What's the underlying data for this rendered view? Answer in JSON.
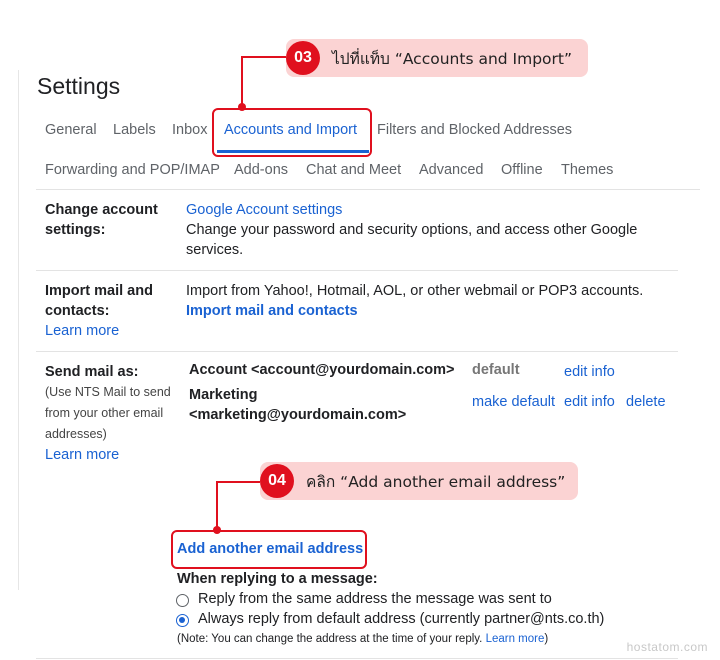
{
  "page_title": "Settings",
  "tabs": {
    "row1": [
      "General",
      "Labels",
      "Inbox",
      "Accounts and Import",
      "Filters and Blocked Addresses"
    ],
    "row2": [
      "Forwarding and POP/IMAP",
      "Add-ons",
      "Chat and Meet",
      "Advanced",
      "Offline",
      "Themes"
    ],
    "active": "Accounts and Import"
  },
  "change_account": {
    "label_line1": "Change account",
    "label_line2": "settings:",
    "link": "Google Account settings",
    "desc_line1": "Change your password and security options, and access other Google",
    "desc_line2": "services."
  },
  "import_mail": {
    "label_line1": "Import mail and",
    "label_line2": "contacts:",
    "learn_more": "Learn more",
    "desc": "Import from Yahoo!, Hotmail, AOL, or other webmail or POP3 accounts.",
    "action_link": "Import mail and contacts"
  },
  "send_mail": {
    "label": "Send mail as:",
    "note_line1": "(Use NTS Mail to send",
    "note_line2": "from your other email",
    "note_line3": "addresses)",
    "learn_more": "Learn more",
    "accounts": [
      {
        "name_line1": "Account <account@yourdomain.com>",
        "name_line2": "",
        "status": "default",
        "actions": [
          "edit info"
        ]
      },
      {
        "name_line1": "Marketing",
        "name_line2": "<marketing@yourdomain.com>",
        "status": "make default",
        "actions": [
          "edit info",
          "delete"
        ]
      }
    ],
    "add_another": "Add another email address"
  },
  "reply": {
    "label": "When replying to a message:",
    "option1": "Reply from the same address the message was sent to",
    "option2": "Always reply from default address (currently partner@nts.co.th)",
    "selected": 2,
    "note_prefix": "(Note: You can change the address at the time of your reply. ",
    "note_link": "Learn more",
    "note_suffix": ")"
  },
  "callouts": [
    {
      "number": "03",
      "text": "ไปที่แท็บ “Accounts and Import”"
    },
    {
      "number": "04",
      "text": "คลิก “Add another email address”"
    }
  ],
  "watermark": "hostatom.com",
  "colors": {
    "accent": "#1a62d2",
    "callout_red": "#e0101e",
    "callout_pill": "#fbd3d3"
  }
}
